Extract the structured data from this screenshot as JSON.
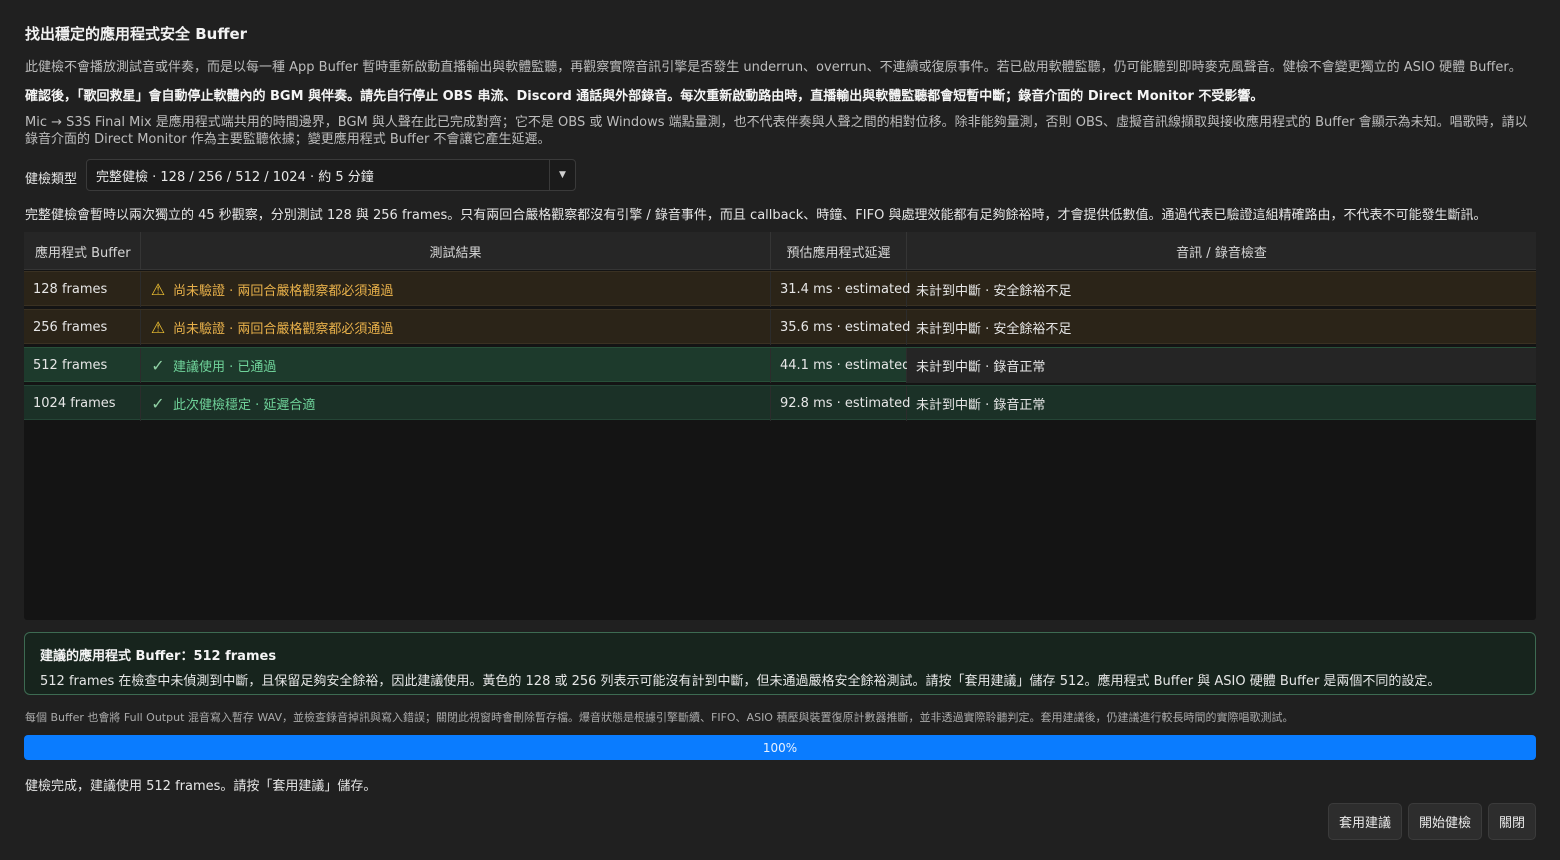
{
  "header": {
    "title": "找出穩定的應用程式安全 Buffer",
    "para1": "此健檢不會播放測試音或伴奏，而是以每一種 App Buffer 暫時重新啟動直播輸出與軟體監聽，再觀察實際音訊引擎是否發生 underrun、overrun、不連續或復原事件。若已啟用軟體監聽，仍可能聽到即時麥克風聲音。健檢不會變更獨立的 ASIO 硬體 Buffer。",
    "para2": "確認後，「歌回救星」會自動停止軟體內的 BGM 與伴奏。請先自行停止 OBS 串流、Discord 通話與外部錄音。每次重新啟動路由時，直播輸出與軟體監聽都會短暫中斷；錄音介面的 Direct Monitor 不受影響。",
    "para3": "Mic → S3S Final Mix 是應用程式端共用的時間邊界，BGM 與人聲在此已完成對齊；它不是 OBS 或 Windows 端點量測，也不代表伴奏與人聲之間的相對位移。除非能夠量測，否則 OBS、虛擬音訊線擷取與接收應用程式的 Buffer 會顯示為未知。唱歌時，請以錄音介面的 Direct Monitor 作為主要監聽依據；變更應用程式 Buffer 不會讓它產生延遲。"
  },
  "check_type": {
    "label": "健檢類型",
    "selected": "完整健檢 · 128 / 256 / 512 / 1024 · 約 5 分鐘"
  },
  "description": "完整健檢會暫時以兩次獨立的 45 秒觀察，分別測試 128 與 256 frames。只有兩回合嚴格觀察都沒有引擎 / 錄音事件，而且 callback、時鐘、FIFO 與處理效能都有足夠餘裕時，才會提供低數值。通過代表已驗證這組精確路由，不代表不可能發生斷訊。",
  "table": {
    "headers": [
      "應用程式 Buffer",
      "測試結果",
      "預估應用程式延遲",
      "音訊 / 錄音檢查"
    ],
    "rows": [
      {
        "buffer": "128 frames",
        "status": "warning",
        "icon": "warning-icon",
        "result": "尚未驗證 · 兩回合嚴格觀察都必須通過",
        "latency": "31.4 ms · estimated",
        "check": "未計到中斷 · 安全餘裕不足"
      },
      {
        "buffer": "256 frames",
        "status": "warning",
        "icon": "warning-icon",
        "result": "尚未驗證 · 兩回合嚴格觀察都必須通過",
        "latency": "35.6 ms · estimated",
        "check": "未計到中斷 · 安全餘裕不足"
      },
      {
        "buffer": "512 frames",
        "status": "recommended",
        "icon": "check-icon",
        "result": "建議使用 · 已通過",
        "latency": "44.1 ms · estimated",
        "check": "未計到中斷 · 錄音正常"
      },
      {
        "buffer": "1024 frames",
        "status": "passed",
        "icon": "check-icon",
        "result": "此次健檢穩定 · 延遲合適",
        "latency": "92.8 ms · estimated",
        "check": "未計到中斷 · 錄音正常"
      }
    ]
  },
  "suggestion": {
    "title": "建議的應用程式 Buffer：512 frames",
    "body": "512 frames 在檢查中未偵測到中斷，且保留足夠安全餘裕，因此建議使用。黃色的 128 或 256 列表示可能沒有計到中斷，但未通過嚴格安全餘裕測試。請按「套用建議」儲存 512。應用程式 Buffer 與 ASIO 硬體 Buffer 是兩個不同的設定。"
  },
  "note": "每個 Buffer 也會將 Full Output 混音寫入暫存 WAV，並檢查錄音掉訊與寫入錯誤；關閉此視窗時會刪除暫存檔。爆音狀態是根據引擎斷續、FIFO、ASIO 積壓與裝置復原計數器推斷，並非透過實際聆聽判定。套用建議後，仍建議進行較長時間的實際唱歌測試。",
  "progress": {
    "percent_label": "100%",
    "value": 1.0
  },
  "status_text": "健檢完成，建議使用 512 frames。請按「套用建議」儲存。",
  "buttons": {
    "apply": "套用建議",
    "start": "開始健檢",
    "close": "關閉"
  },
  "colors": {
    "background": "#202020",
    "progress": "#0a7cff",
    "warning_text": "#e7b04a",
    "ok_text": "#6fd39a",
    "suggest_border": "#3d6b52"
  }
}
